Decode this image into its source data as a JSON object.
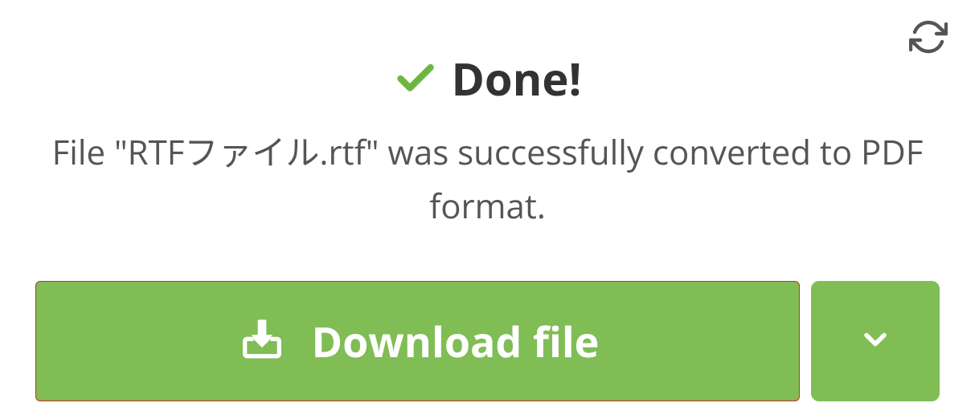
{
  "heading": {
    "title": "Done!"
  },
  "message": "File \"RTFファイル.rtf\" was successfully converted to PDF format.",
  "actions": {
    "download_label": "Download file"
  },
  "colors": {
    "accent": "#80bd55",
    "highlight_border": "#d22828",
    "text_dark": "#333333",
    "text_muted": "#555555"
  }
}
